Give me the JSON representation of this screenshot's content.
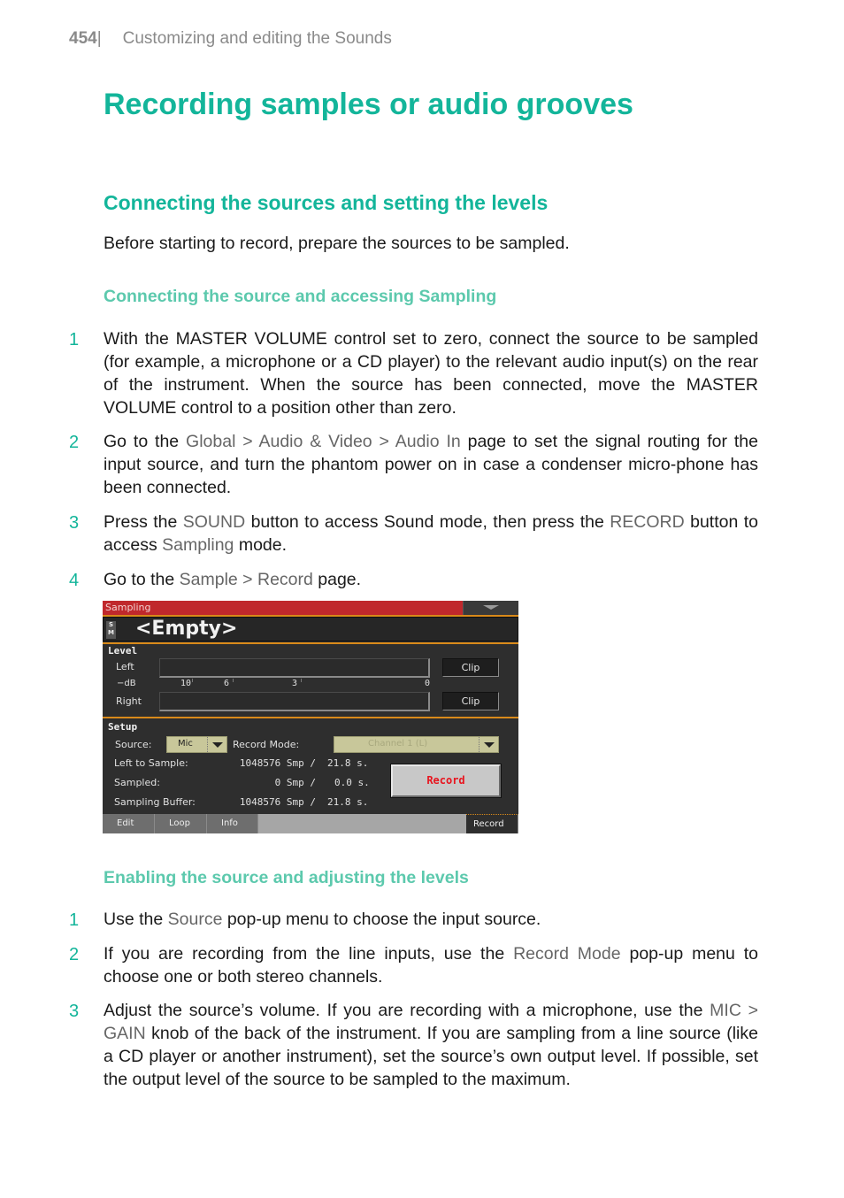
{
  "running_head": {
    "page_number": "454",
    "separator": "|",
    "chapter": "Customizing and editing the Sounds"
  },
  "title": "Recording samples or audio grooves",
  "section": {
    "heading": "Connecting the sources and setting the levels",
    "intro": "Before starting to record, prepare the sources to be sampled."
  },
  "subsection1": {
    "heading": "Connecting the source and accessing Sampling",
    "steps": [
      {
        "num": "1",
        "parts": [
          {
            "t": "With the MASTER VOLUME control set to zero, connect the source to be sampled (for example, a microphone or a CD player) to the relevant audio input(s) on the rear of the instrument. When the source has been connected, move the MASTER VOLUME control to a position other than zero.",
            "kw": false
          }
        ]
      },
      {
        "num": "2",
        "parts": [
          {
            "t": "Go to the ",
            "kw": false
          },
          {
            "t": "Global > Audio & Video > Audio In",
            "kw": true
          },
          {
            "t": " page to set the signal routing for the input source, and turn the phantom power on in case a condenser micro-phone has been connected.",
            "kw": false
          }
        ]
      },
      {
        "num": "3",
        "parts": [
          {
            "t": "Press the ",
            "kw": false
          },
          {
            "t": "SOUND",
            "kw": true
          },
          {
            "t": " button to access Sound mode, then press the ",
            "kw": false
          },
          {
            "t": "RECORD",
            "kw": true
          },
          {
            "t": " button to access ",
            "kw": false
          },
          {
            "t": "Sampling",
            "kw": true
          },
          {
            "t": " mode.",
            "kw": false
          }
        ]
      },
      {
        "num": "4",
        "parts": [
          {
            "t": "Go to the ",
            "kw": false
          },
          {
            "t": "Sample > Record",
            "kw": true
          },
          {
            "t": " page.",
            "kw": false
          }
        ]
      }
    ]
  },
  "screen": {
    "header_title": "Sampling",
    "sample_badge": "S\nM",
    "sample_name": "<Empty>",
    "level": {
      "label": "Level",
      "left_label": "Left",
      "right_label": "Right",
      "db_label": "−dB",
      "scale": [
        "10",
        "6",
        "3",
        "0"
      ],
      "left_level": 0,
      "right_level": 0,
      "clip_label": "Clip"
    },
    "setup": {
      "label": "Setup",
      "source_label": "Source:",
      "source_value": "Mic",
      "record_mode_label": "Record Mode:",
      "record_mode_value": "Channel 1 (L)",
      "left_to_sample_label": "Left to Sample:",
      "left_to_sample_smp": "1048576 Smp /",
      "left_to_sample_sec": "21.8 s.",
      "sampled_label": "Sampled:",
      "sampled_smp": "0 Smp /",
      "sampled_sec": "0.0 s.",
      "buffer_label": "Sampling Buffer:",
      "buffer_smp": "1048576 Smp /",
      "buffer_sec": "21.8 s."
    },
    "record_button": "Record",
    "tabs": [
      "Edit",
      "Loop",
      "Info"
    ],
    "active_tab": "Record"
  },
  "subsection2": {
    "heading": "Enabling the source and adjusting the levels",
    "steps": [
      {
        "num": "1",
        "parts": [
          {
            "t": "Use the ",
            "kw": false
          },
          {
            "t": "Source",
            "kw": true
          },
          {
            "t": " pop-up menu to choose the input source.",
            "kw": false
          }
        ]
      },
      {
        "num": "2",
        "parts": [
          {
            "t": "If you are recording from the line inputs, use the ",
            "kw": false
          },
          {
            "t": "Record Mode",
            "kw": true
          },
          {
            "t": " pop-up menu to choose one or both stereo channels.",
            "kw": false
          }
        ]
      },
      {
        "num": "3",
        "parts": [
          {
            "t": "Adjust the source’s volume. If you are recording with a microphone, use the ",
            "kw": false
          },
          {
            "t": "MIC > GAIN",
            "kw": true
          },
          {
            "t": " knob of the back of the instrument. If you are sampling from a line source (like a CD player or another instrument), set the source’s own output level. If possible, set the output level of the source to be sampled to the maximum.",
            "kw": false
          }
        ]
      }
    ]
  },
  "colors": {
    "accent": "#13b59a",
    "subheading": "#5cc9ad",
    "keyword": "#666666",
    "screen_header": "#c0282c",
    "record_text": "#e8141e"
  }
}
